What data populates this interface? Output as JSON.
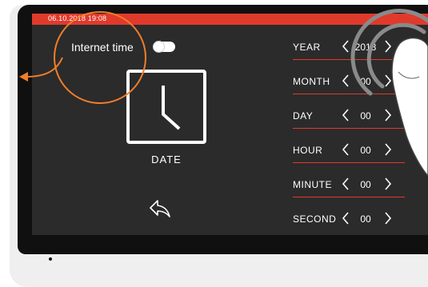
{
  "status_bar": {
    "datetime": "06.10.2018  19:08"
  },
  "internet_time": {
    "label": "Internet time",
    "enabled": false
  },
  "left_panel": {
    "date_label": "DATE",
    "icon": "clock-icon",
    "back_icon": "back-arrow-icon"
  },
  "fields": [
    {
      "label": "YEAR",
      "value": "2018"
    },
    {
      "label": "MONTH",
      "value": "00"
    },
    {
      "label": "DAY",
      "value": "00"
    },
    {
      "label": "HOUR",
      "value": "00"
    },
    {
      "label": "MINUTE",
      "value": "00"
    },
    {
      "label": "SECOND",
      "value": "00"
    }
  ],
  "colors": {
    "accent": "#e03a2c",
    "annotation": "#f07e2a",
    "screen_bg": "#2b2b2b",
    "text": "#ffffff"
  }
}
